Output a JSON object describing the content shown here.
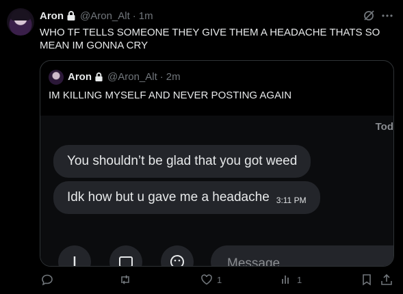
{
  "post": {
    "author_name": "Aron",
    "handle": "@Aron_Alt",
    "separator": "·",
    "time": "1m",
    "text": "WHO TF TELLS SOMEONE THEY GIVE THEM A HEADACHE THATS SO MEAN IM GONNA CRY"
  },
  "quote": {
    "author_name": "Aron",
    "handle": "@Aron_Alt",
    "separator": "·",
    "time": "2m",
    "text": "IM KILLING MYSELF AND NEVER POSTING AGAIN",
    "media": {
      "day_label": "Tod",
      "messages": [
        {
          "text": "You shouldn’t be glad that you got weed"
        },
        {
          "text": "Idk how but u gave me a headache",
          "time": "3:11 PM"
        }
      ],
      "input_placeholder": "Message"
    }
  },
  "actions": {
    "reply_count": "",
    "repost_count": "",
    "like_count": "1",
    "views_count": "1"
  },
  "icons": [
    "lock-icon",
    "grok-icon",
    "more-icon",
    "reply-icon",
    "repost-icon",
    "like-icon",
    "views-icon",
    "bookmark-icon",
    "share-icon"
  ]
}
